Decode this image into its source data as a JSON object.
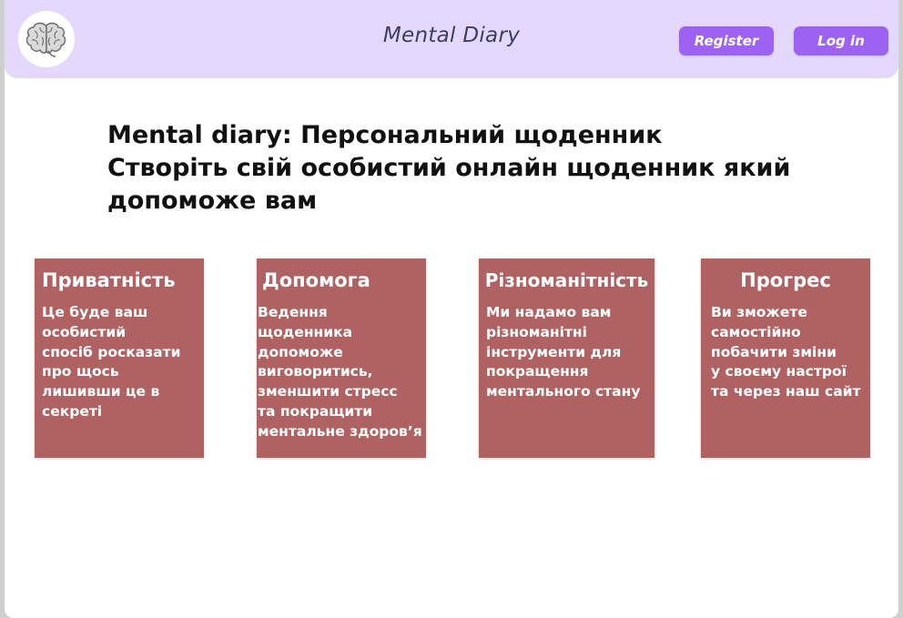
{
  "header": {
    "logo_icon": "brain-icon",
    "title": "Mental Diary",
    "register_label": "Register",
    "login_label": "Log in"
  },
  "hero": {
    "line1": "Mental diary: Персональний щоденник",
    "line2": "Створіть свій особистий онлайн щоденник який",
    "line3": "допоможе вам"
  },
  "cards": [
    {
      "title": "Приватність",
      "text": "Це буде ваш\nособистий\nспосіб росказати\nпро щось\nлишивши це в\nсекреті"
    },
    {
      "title": "Допомога",
      "text": "Ведення щоденника\nдопоможе\nвиговоритись,\nзменшити стресс\nта покращити\nментальне здоров’я"
    },
    {
      "title": "Різноманітність",
      "text": "Ми надамо вам\nрізноманітні\nінструменти для\nпокращення\nментального стану"
    },
    {
      "title": "Прогрес",
      "text": "Ви зможете\nсамостійно\nпобачити зміни\nу своєму настрої\nта через наш сайт"
    }
  ],
  "colors": {
    "header_bg": "#e4d9fc",
    "button_bg": "#9d62f1",
    "card_bg": "#b06161",
    "title_color": "#3d3f5e"
  }
}
